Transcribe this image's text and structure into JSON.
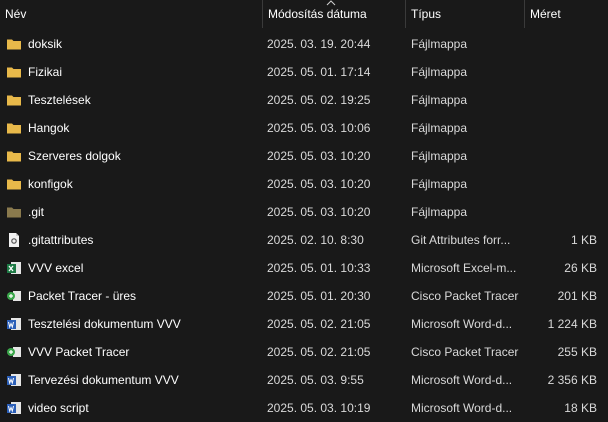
{
  "columns": {
    "name": "Név",
    "date": "Módosítás dátuma",
    "type": "Típus",
    "size": "Méret"
  },
  "files": [
    {
      "name": "doksik",
      "date": "2025. 03. 19. 20:44",
      "type": "Fájlmappa",
      "size": "",
      "icon": "folder-icon"
    },
    {
      "name": "Fizikai",
      "date": "2025. 05. 01. 17:14",
      "type": "Fájlmappa",
      "size": "",
      "icon": "folder-icon"
    },
    {
      "name": "Tesztelések",
      "date": "2025. 05. 02. 19:25",
      "type": "Fájlmappa",
      "size": "",
      "icon": "folder-icon"
    },
    {
      "name": "Hangok",
      "date": "2025. 05. 03. 10:06",
      "type": "Fájlmappa",
      "size": "",
      "icon": "folder-icon"
    },
    {
      "name": "Szerveres dolgok",
      "date": "2025. 05. 03. 10:20",
      "type": "Fájlmappa",
      "size": "",
      "icon": "folder-icon"
    },
    {
      "name": "konfigok",
      "date": "2025. 05. 03. 10:20",
      "type": "Fájlmappa",
      "size": "",
      "icon": "folder-icon"
    },
    {
      "name": ".git",
      "date": "2025. 05. 03. 10:20",
      "type": "Fájlmappa",
      "size": "",
      "icon": "hidden-folder-icon"
    },
    {
      "name": ".gitattributes",
      "date": "2025. 02. 10. 8:30",
      "type": "Git Attributes forr...",
      "size": "1 KB",
      "icon": "text-file-icon"
    },
    {
      "name": "VVV excel",
      "date": "2025. 05. 01. 10:33",
      "type": "Microsoft Excel-m...",
      "size": "26 KB",
      "icon": "excel-file-icon"
    },
    {
      "name": "Packet Tracer - üres",
      "date": "2025. 05. 01. 20:30",
      "type": "Cisco Packet Tracer",
      "size": "201 KB",
      "icon": "packet-tracer-file-icon"
    },
    {
      "name": "Tesztelési dokumentum VVV",
      "date": "2025. 05. 02. 21:05",
      "type": "Microsoft Word-d...",
      "size": "1 224 KB",
      "icon": "word-file-icon"
    },
    {
      "name": "VVV Packet Tracer",
      "date": "2025. 05. 02. 21:05",
      "type": "Cisco Packet Tracer",
      "size": "255 KB",
      "icon": "packet-tracer-file-icon"
    },
    {
      "name": "Tervezési dokumentum VVV",
      "date": "2025. 05. 03. 9:55",
      "type": "Microsoft Word-d...",
      "size": "2 356 KB",
      "icon": "word-file-icon"
    },
    {
      "name": "video script",
      "date": "2025. 05. 03. 10:19",
      "type": "Microsoft Word-d...",
      "size": "18 KB",
      "icon": "word-file-icon"
    }
  ],
  "colors": {
    "background": "#191919",
    "folder": "#e8b84a",
    "hidden_folder": "#8a7a4e",
    "excel": "#1d7a45",
    "word": "#2b5fb8",
    "packet_tracer": "#3aa64a"
  }
}
